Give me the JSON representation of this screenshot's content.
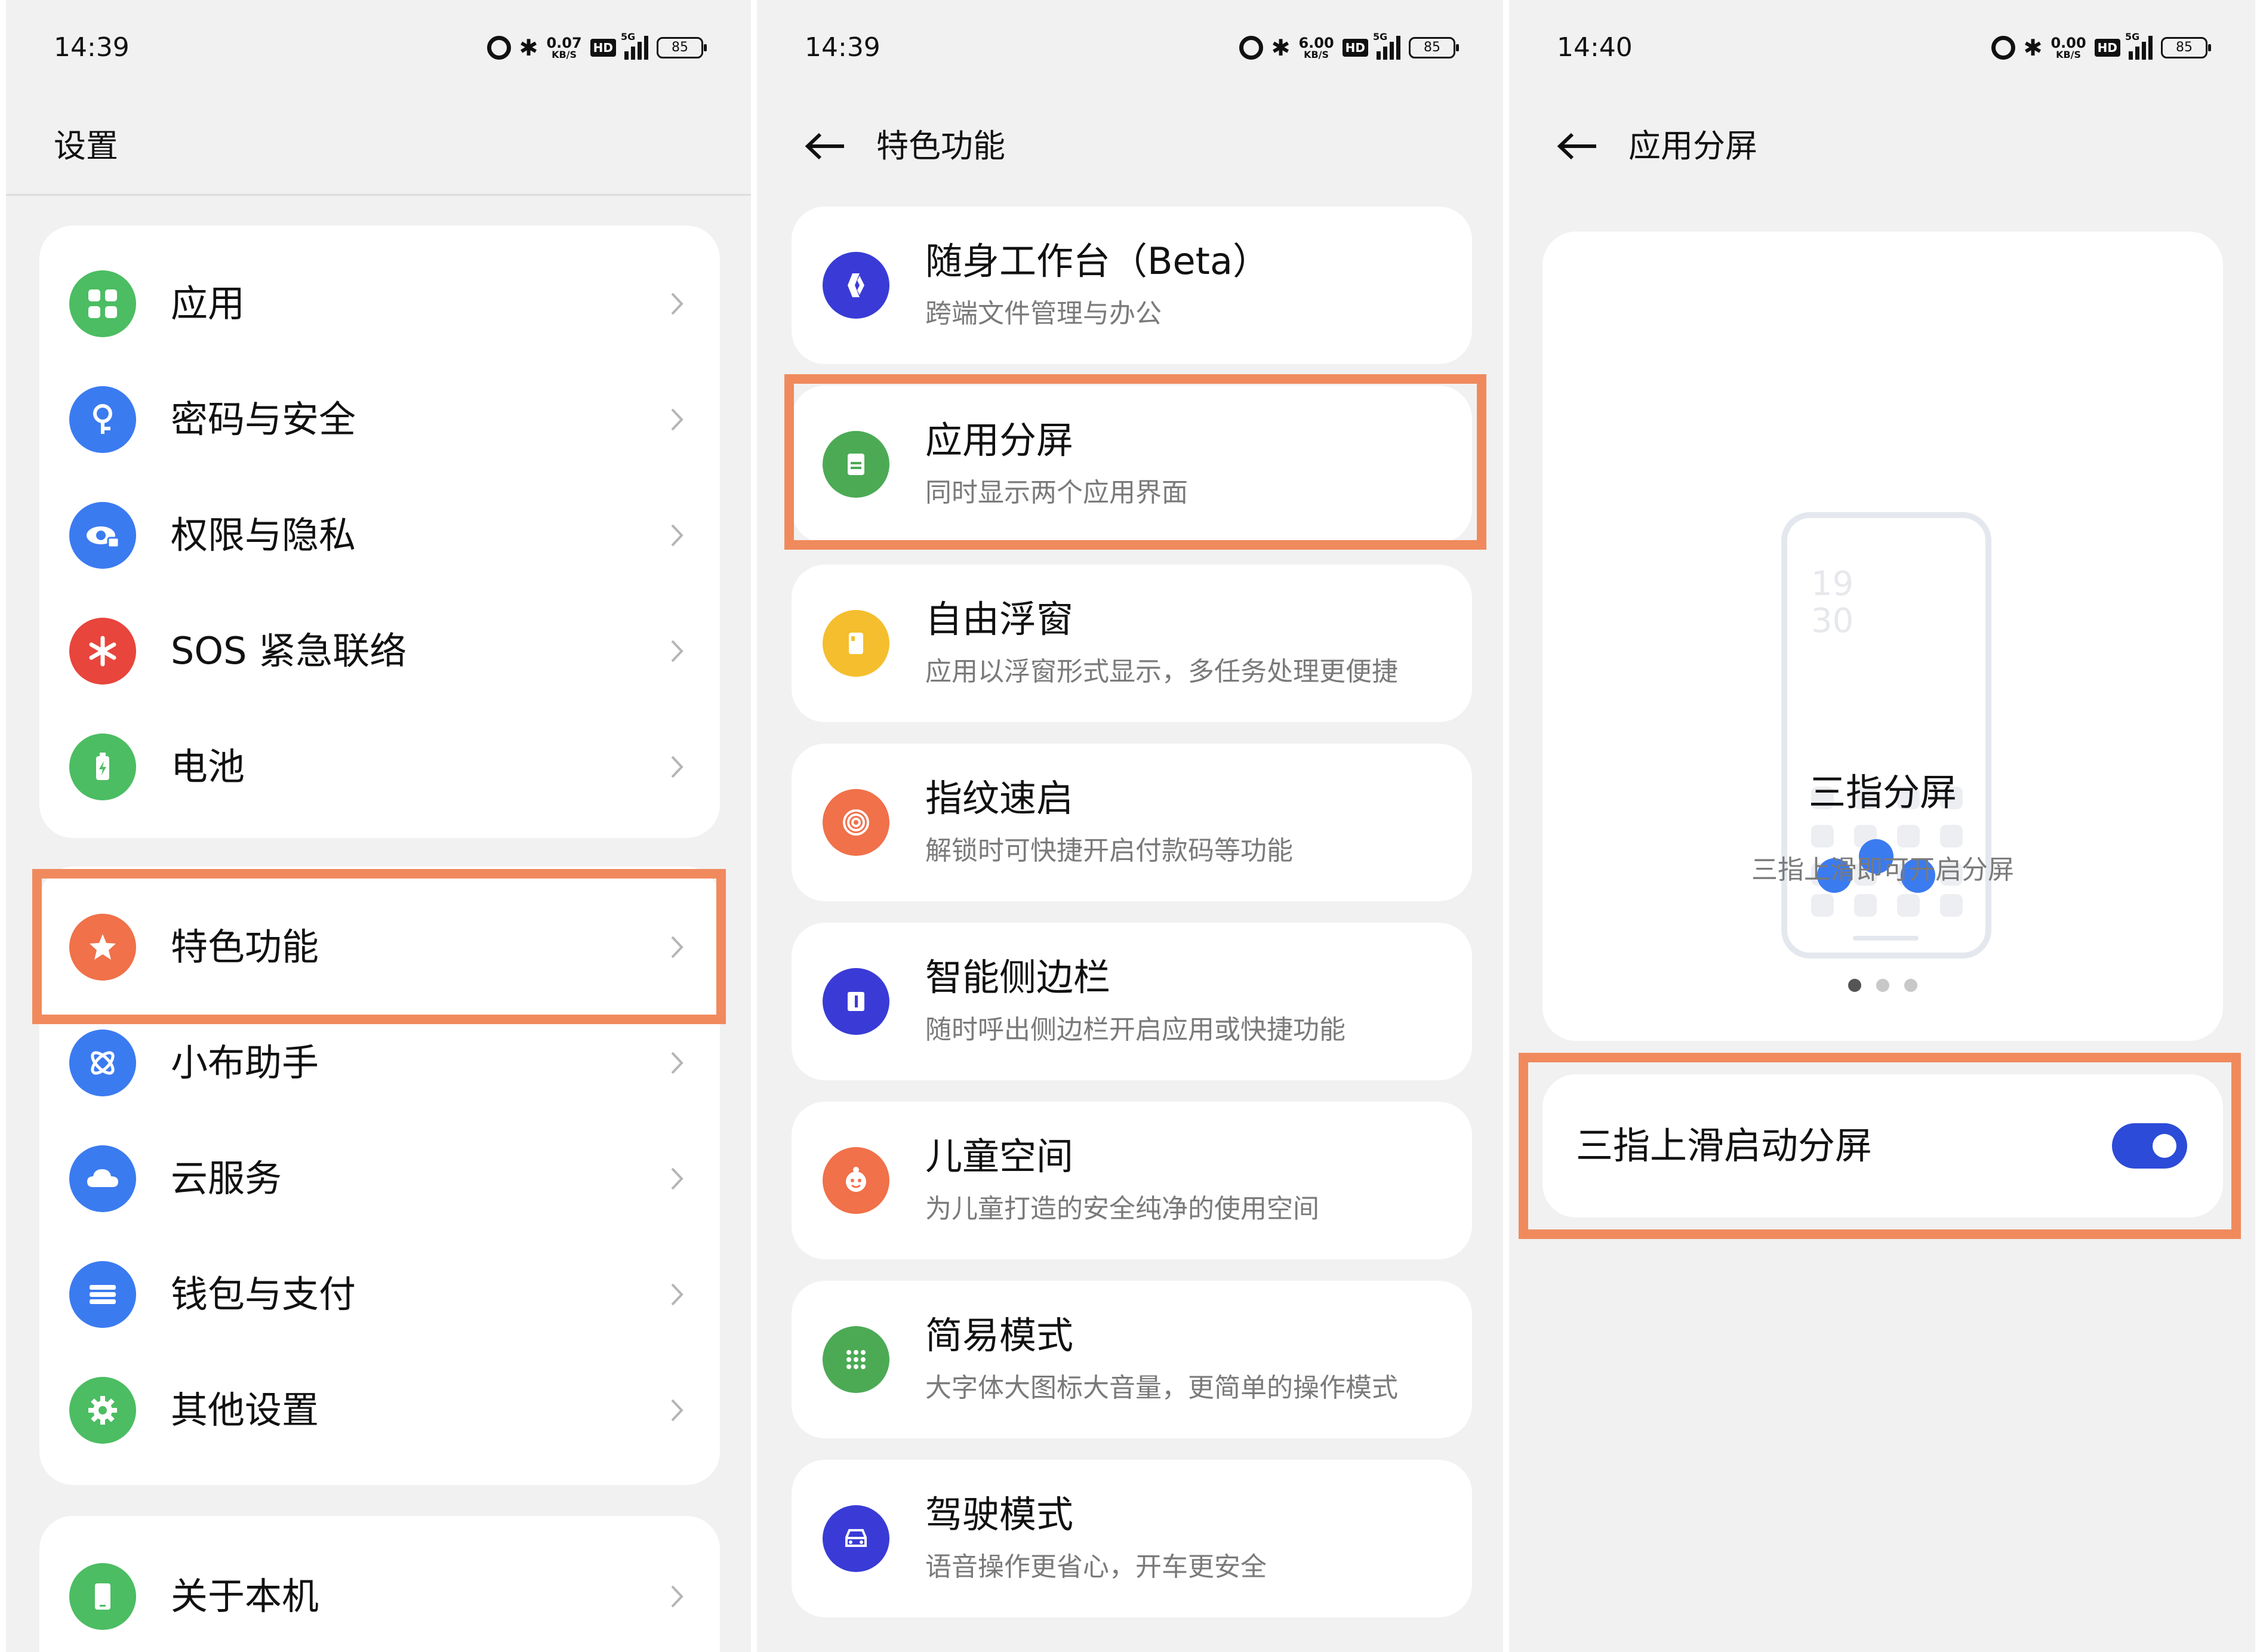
{
  "status_bars": [
    {
      "time": "14:39",
      "speed": "0.07",
      "speed_unit": "KB/S",
      "hd": "HD",
      "net": "5G",
      "battery": "85"
    },
    {
      "time": "14:39",
      "speed": "6.00",
      "speed_unit": "KB/S",
      "hd": "HD",
      "net": "5G",
      "battery": "85"
    },
    {
      "time": "14:40",
      "speed": "0.00",
      "speed_unit": "KB/S",
      "hd": "HD",
      "net": "5G",
      "battery": "85"
    }
  ],
  "settings": {
    "title": "设置",
    "group1": [
      {
        "label": "应用",
        "icon": "apps-icon",
        "color": "#4cbd62"
      },
      {
        "label": "密码与安全",
        "icon": "key-icon",
        "color": "#3b7bf0"
      },
      {
        "label": "权限与隐私",
        "icon": "privacy-eye-icon",
        "color": "#3b7bf0"
      },
      {
        "label": "SOS 紧急联络",
        "icon": "sos-asterisk-icon",
        "color": "#e8453c"
      },
      {
        "label": "电池",
        "icon": "battery-icon",
        "color": "#4cbd62"
      }
    ],
    "group2": [
      {
        "label": "特色功能",
        "icon": "star-icon",
        "color": "#f0714a"
      },
      {
        "label": "小布助手",
        "icon": "assistant-icon",
        "color": "#3b7bf0"
      },
      {
        "label": "云服务",
        "icon": "cloud-icon",
        "color": "#3b7bf0"
      },
      {
        "label": "钱包与支付",
        "icon": "wallet-icon",
        "color": "#3b7bf0"
      },
      {
        "label": "其他设置",
        "icon": "gear-icon",
        "color": "#4cbd62"
      }
    ],
    "group3": [
      {
        "label": "关于本机",
        "icon": "phone-icon",
        "color": "#4cbd62"
      }
    ]
  },
  "features": {
    "title": "特色功能",
    "items": [
      {
        "title": "随身工作台（Beta）",
        "subtitle": "跨端文件管理与办公",
        "icon": "workbench-icon",
        "color": "#3a3bd6"
      },
      {
        "title": "应用分屏",
        "subtitle": "同时显示两个应用界面",
        "icon": "split-screen-icon",
        "color": "#4caa55"
      },
      {
        "title": "自由浮窗",
        "subtitle": "应用以浮窗形式显示，多任务处理更便捷",
        "icon": "floating-window-icon",
        "color": "#f5be2e"
      },
      {
        "title": "指纹速启",
        "subtitle": "解锁时可快捷开启付款码等功能",
        "icon": "fingerprint-icon",
        "color": "#f0714a"
      },
      {
        "title": "智能侧边栏",
        "subtitle": "随时呼出侧边栏开启应用或快捷功能",
        "icon": "sidebar-icon",
        "color": "#3a3bd6"
      },
      {
        "title": "儿童空间",
        "subtitle": "为儿童打造的安全纯净的使用空间",
        "icon": "child-face-icon",
        "color": "#f0714a"
      },
      {
        "title": "简易模式",
        "subtitle": "大字体大图标大音量，更简单的操作模式",
        "icon": "dots-grid-icon",
        "color": "#4caa55"
      },
      {
        "title": "驾驶模式",
        "subtitle": "语音操作更省心，开车更安全",
        "icon": "car-icon",
        "color": "#3a3bd6"
      }
    ]
  },
  "split": {
    "title": "应用分屏",
    "preview_clock_hour": "19",
    "preview_clock_min": "30",
    "heading": "三指分屏",
    "desc": "三指上滑即可开启分屏",
    "page_count": 3,
    "current_page": 1,
    "toggle_label": "三指上滑启动分屏",
    "toggle_on": true
  },
  "colors": {
    "highlight": "#f08a5d",
    "toggle": "#2c4bd8",
    "accent_blue": "#3b7bf0"
  }
}
